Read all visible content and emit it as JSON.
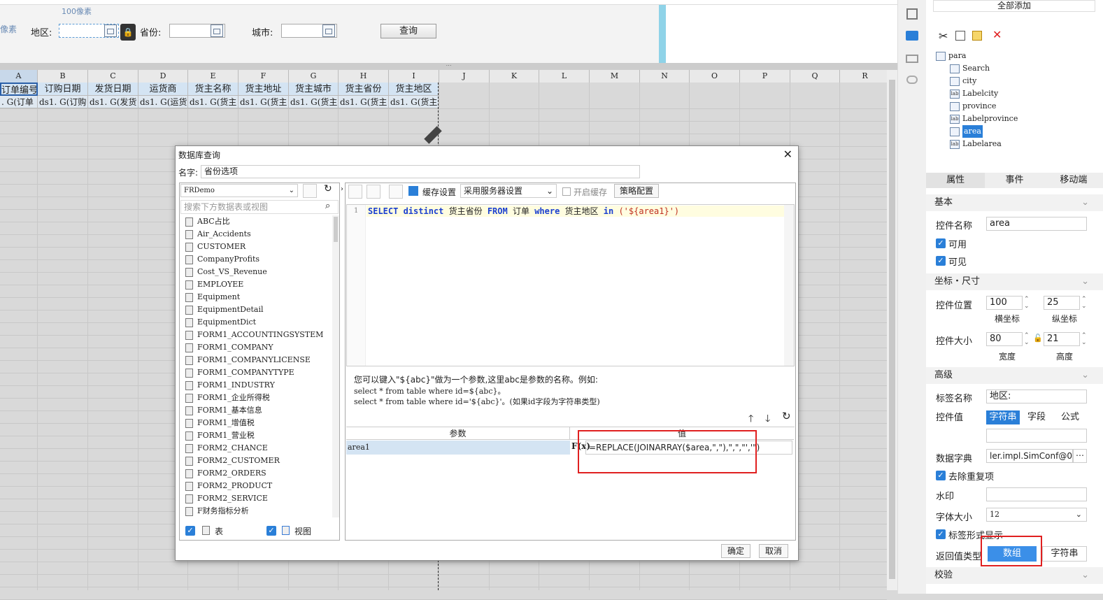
{
  "param_panel": {
    "ruler_hint": "100像素",
    "left_hint": "像素",
    "area_label": "地区:",
    "province_label": "省份:",
    "city_label": "城市:",
    "query_button": "查询"
  },
  "sheet": {
    "columns": [
      "A",
      "B",
      "C",
      "D",
      "E",
      "F",
      "G",
      "H",
      "I",
      "J",
      "K",
      "L",
      "M",
      "N",
      "O",
      "P",
      "Q",
      "R"
    ],
    "headers": [
      "订单编号",
      "订购日期",
      "发货日期",
      "运货商",
      "货主名称",
      "货主地址",
      "货主城市",
      "货主省份",
      "货主地区"
    ],
    "row2": [
      ". G(订单",
      "ds1. G(订购",
      "ds1. G(发货",
      "ds1. G(运货",
      "ds1. G(货主",
      "ds1. G(货主",
      "ds1. G(货主",
      "ds1. G(货主",
      "ds1. G(货主"
    ]
  },
  "dialog": {
    "title": "数据库查询",
    "name_label": "名字:",
    "name_value": "省份选项",
    "connection": "FRDemo",
    "search_placeholder": "搜索下方数据表或视图",
    "tables": [
      "ABC占比",
      "Air_Accidents",
      "CUSTOMER",
      "CompanyProfits",
      "Cost_VS_Revenue",
      "EMPLOYEE",
      "Equipment",
      "EquipmentDetail",
      "EquipmentDict",
      "FORM1_ACCOUNTINGSYSTEM",
      "FORM1_COMPANY",
      "FORM1_COMPANYLICENSE",
      "FORM1_COMPANYTYPE",
      "FORM1_INDUSTRY",
      "FORM1_企业所得税",
      "FORM1_基本信息",
      "FORM1_增值税",
      "FORM1_营业税",
      "FORM2_CHANCE",
      "FORM2_CUSTOMER",
      "FORM2_ORDERS",
      "FORM2_PRODUCT",
      "FORM2_SERVICE",
      "F财务指标分析"
    ],
    "table_check_label": "表",
    "view_check_label": "视图",
    "cache_settings": "缓存设置",
    "cache_option": "采用服务器设置",
    "enable_cache": "开启缓存",
    "strategy": "策略配置",
    "sql_line_no": "1",
    "sql": {
      "select": "SELECT distinct",
      "col": " 货主省份 ",
      "from": "FROM",
      "tbl": " 订单 ",
      "where": "where",
      "col2": " 货主地区 ",
      "in": "in",
      "param": " ('${area1}')"
    },
    "help_line1": "您可以键入\"${abc}\"做为一个参数,这里abc是参数的名称。例如:",
    "help_line2": "select * from table where id=${abc}。",
    "help_line3": "select * from table where id='${abc}'。(如果id字段为字符串类型)",
    "param_header": "参数",
    "value_header": "值",
    "param_name": "area1",
    "param_value": "=REPLACE(JOINARRAY($area,\",\"),\",\",\"','\")",
    "ok_button": "确定",
    "cancel_button": "取消"
  },
  "right_panel": {
    "add_all": "全部添加",
    "tree": [
      {
        "icon": "form",
        "label": "para",
        "indent": 0
      },
      {
        "icon": "search",
        "label": "Search",
        "indent": 1
      },
      {
        "icon": "combo",
        "label": "city",
        "indent": 1
      },
      {
        "icon": "lab",
        "label": "Labelcity",
        "indent": 1
      },
      {
        "icon": "combo",
        "label": "province",
        "indent": 1
      },
      {
        "icon": "lab",
        "label": "Labelprovince",
        "indent": 1
      },
      {
        "icon": "combo",
        "label": "area",
        "indent": 1
      },
      {
        "icon": "lab",
        "label": "Labelarea",
        "indent": 1
      }
    ],
    "tabs": [
      "属性",
      "事件",
      "移动端"
    ],
    "basic": "基本",
    "widget_name_label": "控件名称",
    "widget_name": "area",
    "enabled": "可用",
    "visible": "可见",
    "coord_size": "坐标・尺寸",
    "position_label": "控件位置",
    "pos_x": "100",
    "pos_y": "25",
    "x_caption": "横坐标",
    "y_caption": "纵坐标",
    "size_label": "控件大小",
    "width": "80",
    "height": "21",
    "w_caption": "宽度",
    "h_caption": "高度",
    "advanced": "高级",
    "tag_name_label": "标签名称",
    "tag_name": "地区:",
    "value_label": "控件值",
    "value_tabs": [
      "字符串",
      "字段",
      "公式"
    ],
    "dict_label": "数据字典",
    "dict_value": "ler.impl.SimConf@0]",
    "dedupe": "去除重复项",
    "watermark_label": "水印",
    "font_size_label": "字体大小",
    "font_size": "12",
    "label_display": "标签形式显示",
    "return_type_label": "返回值类型",
    "return_array": "数组",
    "return_string": "字符串",
    "validate": "校验"
  },
  "colors": {
    "accent": "#2a7fd8",
    "highlight_red": "#e02020",
    "sql_bg": "#fffde0"
  }
}
